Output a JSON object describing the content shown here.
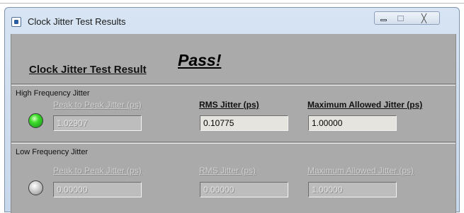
{
  "window": {
    "title": "Clock Jitter Test Results",
    "controls": {
      "minimize": "minimize-icon",
      "maximize": "maximize-icon",
      "close_glyph": "╳"
    }
  },
  "result": {
    "label": "Clock Jitter Test Result",
    "status": "Pass!"
  },
  "high_frequency": {
    "section_label": "High Frequency Jitter",
    "led_state": "on",
    "led_color": "#3cdc2a",
    "peak_to_peak_label": "Peak to Peak Jitter (ps)",
    "peak_to_peak_value": "1.02907",
    "rms_label": "RMS Jitter (ps)",
    "rms_value": "0.10775",
    "max_allowed_label": "Maximum Allowed  Jitter (ps)",
    "max_allowed_value": "1.00000"
  },
  "low_frequency": {
    "section_label": "Low Frequency Jitter",
    "led_state": "off",
    "led_color": "#d7d7d7",
    "peak_to_peak_label": "Peak to Peak Jitter (ps)",
    "peak_to_peak_value": "0.00000",
    "rms_label": "RMS Jitter (ps)",
    "rms_value": "0.00000",
    "max_allowed_label": "Maximum Allowed  Jitter (ps)",
    "max_allowed_value": "1.00000"
  }
}
